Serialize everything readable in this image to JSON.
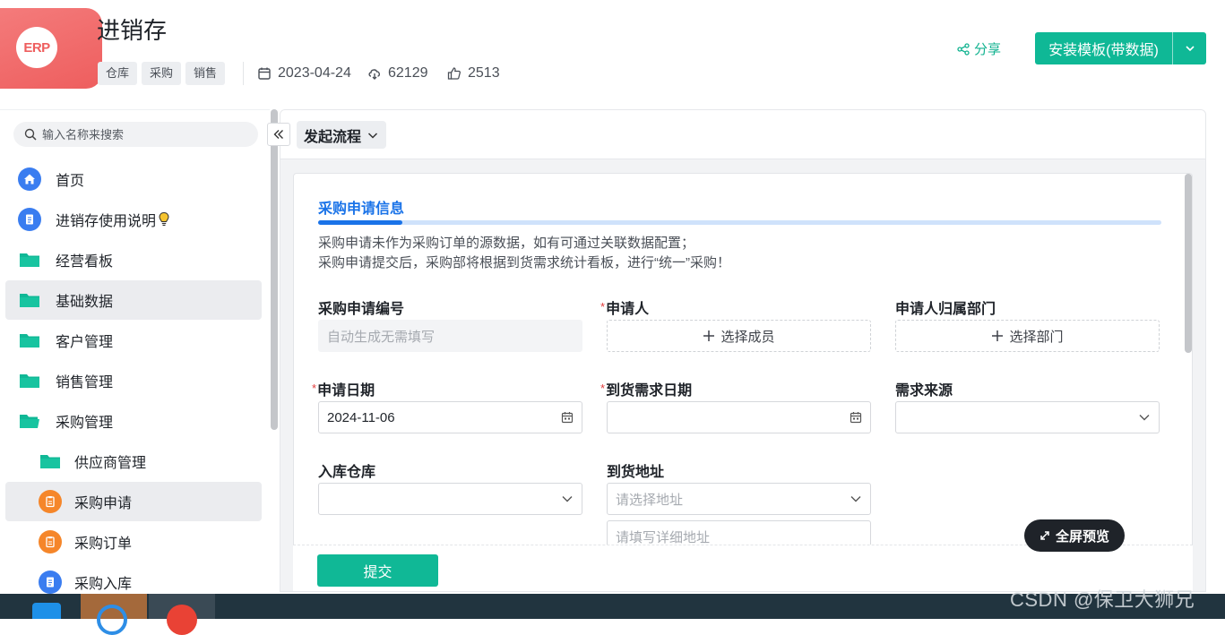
{
  "app": {
    "logo_text": "ERP",
    "title": "进销存",
    "tags": [
      "仓库",
      "采购",
      "销售"
    ],
    "date": "2023-04-24",
    "downloads": "62129",
    "likes": "2513",
    "share_label": "分享",
    "install_label": "安装模板(带数据)"
  },
  "sidebar": {
    "search_placeholder": "输入名称来搜索",
    "items": [
      {
        "label": "首页",
        "icon": "home-icon",
        "active": false
      },
      {
        "label": "进销存使用说明",
        "icon": "document-icon",
        "active": false
      },
      {
        "label": "经营看板",
        "icon": "folder-icon",
        "active": false
      },
      {
        "label": "基础数据",
        "icon": "folder-icon",
        "active": true
      },
      {
        "label": "客户管理",
        "icon": "folder-icon",
        "active": false
      },
      {
        "label": "销售管理",
        "icon": "folder-icon",
        "active": false
      },
      {
        "label": "采购管理",
        "icon": "folder-open-icon",
        "active": false
      },
      {
        "label": "供应商管理",
        "icon": "folder-icon",
        "active": false
      },
      {
        "label": "采购申请",
        "icon": "form-icon",
        "active": true
      },
      {
        "label": "采购订单",
        "icon": "form-icon",
        "active": false
      },
      {
        "label": "采购入库",
        "icon": "document-icon",
        "active": false
      }
    ]
  },
  "main": {
    "flow_label": "发起流程",
    "section_title": "采购申请信息",
    "desc_line1": "采购申请未作为采购订单的源数据，如有可通过关联数据配置；",
    "desc_line2": "采购申请提交后，采购部将根据到货需求统计看板，进行“统一”采购！",
    "fields": {
      "request_no": {
        "label": "采购申请编号",
        "placeholder": "自动生成无需填写"
      },
      "applicant": {
        "label": "申请人",
        "button": "选择成员",
        "required": true
      },
      "department": {
        "label": "申请人归属部门",
        "button": "选择部门"
      },
      "apply_date": {
        "label": "申请日期",
        "value": "2024-11-06",
        "required": true
      },
      "arrival_date": {
        "label": "到货需求日期",
        "value": "",
        "required": true
      },
      "demand_source": {
        "label": "需求来源",
        "value": ""
      },
      "warehouse": {
        "label": "入库仓库",
        "value": ""
      },
      "address": {
        "label": "到货地址",
        "placeholder": "请选择地址",
        "detail_placeholder": "请填写详细地址"
      }
    },
    "submit_label": "提交",
    "fullscreen_label": "全屏预览"
  },
  "watermark": "CSDN @保卫大狮兄",
  "colors": {
    "accent": "#0fb896",
    "brand_red": "#ee5e5e",
    "blue": "#1a73e8"
  }
}
